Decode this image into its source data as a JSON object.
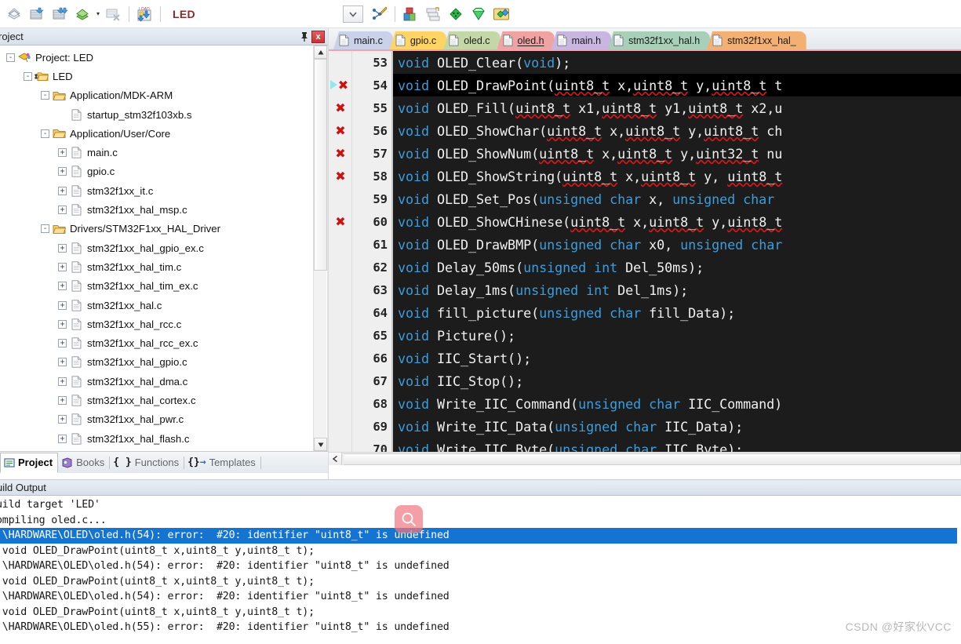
{
  "toolbar": {
    "target_name": "LED",
    "buttons": [
      {
        "name": "translate-icon",
        "icon": "translate"
      },
      {
        "name": "build-icon",
        "icon": "build"
      },
      {
        "name": "rebuild-icon",
        "icon": "rebuild"
      },
      {
        "name": "batch-build-icon",
        "icon": "batchbuild"
      },
      {
        "name": "stop-build-icon",
        "icon": "stopbuild"
      },
      {
        "name": "download-icon",
        "icon": "download"
      }
    ],
    "right_buttons": [
      {
        "name": "target-options-icon",
        "icon": "magicwand"
      },
      {
        "name": "manage-project-items-icon",
        "icon": "project"
      },
      {
        "name": "manage-multi-project-icon",
        "icon": "multiproj"
      },
      {
        "name": "pack-installer-icon",
        "icon": "green-diamond"
      },
      {
        "name": "manage-runtime-env-icon",
        "icon": "green-gem"
      },
      {
        "name": "components-icon",
        "icon": "components"
      }
    ],
    "combo_caret": "▾"
  },
  "project_panel": {
    "title": "roject",
    "pin_tooltip": "Auto Hide",
    "close_label": "x",
    "tree": [
      {
        "label": "Project: LED",
        "depth": 0,
        "twist": "-",
        "icon": "project",
        "bold": false
      },
      {
        "label": "LED",
        "depth": 1,
        "twist": "-",
        "icon": "target",
        "bold": false
      },
      {
        "label": "Application/MDK-ARM",
        "depth": 2,
        "twist": "-",
        "icon": "folder",
        "bold": false
      },
      {
        "label": "startup_stm32f103xb.s",
        "depth": 3,
        "twist": "",
        "icon": "file",
        "bold": false
      },
      {
        "label": "Application/User/Core",
        "depth": 2,
        "twist": "-",
        "icon": "folder",
        "bold": false
      },
      {
        "label": "main.c",
        "depth": 3,
        "twist": "+",
        "icon": "file",
        "bold": false
      },
      {
        "label": "gpio.c",
        "depth": 3,
        "twist": "+",
        "icon": "file",
        "bold": false
      },
      {
        "label": "stm32f1xx_it.c",
        "depth": 3,
        "twist": "+",
        "icon": "file",
        "bold": false
      },
      {
        "label": "stm32f1xx_hal_msp.c",
        "depth": 3,
        "twist": "+",
        "icon": "file",
        "bold": false
      },
      {
        "label": "Drivers/STM32F1xx_HAL_Driver",
        "depth": 2,
        "twist": "-",
        "icon": "folder",
        "bold": false
      },
      {
        "label": "stm32f1xx_hal_gpio_ex.c",
        "depth": 3,
        "twist": "+",
        "icon": "file",
        "bold": false
      },
      {
        "label": "stm32f1xx_hal_tim.c",
        "depth": 3,
        "twist": "+",
        "icon": "file",
        "bold": false
      },
      {
        "label": "stm32f1xx_hal_tim_ex.c",
        "depth": 3,
        "twist": "+",
        "icon": "file",
        "bold": false
      },
      {
        "label": "stm32f1xx_hal.c",
        "depth": 3,
        "twist": "+",
        "icon": "file",
        "bold": false
      },
      {
        "label": "stm32f1xx_hal_rcc.c",
        "depth": 3,
        "twist": "+",
        "icon": "file",
        "bold": false
      },
      {
        "label": "stm32f1xx_hal_rcc_ex.c",
        "depth": 3,
        "twist": "+",
        "icon": "file",
        "bold": false
      },
      {
        "label": "stm32f1xx_hal_gpio.c",
        "depth": 3,
        "twist": "+",
        "icon": "file",
        "bold": false
      },
      {
        "label": "stm32f1xx_hal_dma.c",
        "depth": 3,
        "twist": "+",
        "icon": "file",
        "bold": false
      },
      {
        "label": "stm32f1xx_hal_cortex.c",
        "depth": 3,
        "twist": "+",
        "icon": "file",
        "bold": false
      },
      {
        "label": "stm32f1xx_hal_pwr.c",
        "depth": 3,
        "twist": "+",
        "icon": "file",
        "bold": false
      },
      {
        "label": "stm32f1xx_hal_flash.c",
        "depth": 3,
        "twist": "+",
        "icon": "file",
        "bold": false
      }
    ],
    "bottom_tabs": [
      {
        "label": "Project",
        "icon": "project-icon",
        "active": true
      },
      {
        "label": "Books",
        "icon": "books-icon",
        "active": false
      },
      {
        "label": "Functions",
        "icon": "functions-icon",
        "active": false
      },
      {
        "label": "Templates",
        "icon": "templates-icon",
        "active": false
      }
    ]
  },
  "editor": {
    "tabs": [
      {
        "label": "main.c",
        "color": "#c9d2e8",
        "active": false
      },
      {
        "label": "gpio.c",
        "color": "#ffd465",
        "active": false
      },
      {
        "label": "oled.c",
        "color": "#c3d8a6",
        "active": false
      },
      {
        "label": "oled.h",
        "color": "#f0a3a3",
        "active": true
      },
      {
        "label": "main.h",
        "color": "#c8b6e0",
        "active": false
      },
      {
        "label": "stm32f1xx_hal.h",
        "color": "#a8cfb8",
        "active": false
      },
      {
        "label": "stm32f1xx_hal_",
        "color": "#f2b173",
        "active": false
      }
    ],
    "first_line": 53,
    "lines": [
      {
        "num": 53,
        "marker": "none",
        "highlight": false,
        "tokens": [
          {
            "t": "void ",
            "c": "kw"
          },
          {
            "t": "OLED_Clear(",
            "c": "id"
          },
          {
            "t": "void",
            "c": "kw"
          },
          {
            "t": ");",
            "c": "id"
          }
        ]
      },
      {
        "num": 54,
        "marker": "error-bp",
        "highlight": true,
        "tokens": [
          {
            "t": "void ",
            "c": "kw"
          },
          {
            "t": "OLED_DrawPoint(",
            "c": "id"
          },
          {
            "t": "uint8_t",
            "c": "sq"
          },
          {
            "t": " x,",
            "c": "id"
          },
          {
            "t": "uint8_t",
            "c": "sq"
          },
          {
            "t": " y,",
            "c": "id"
          },
          {
            "t": "uint8_t",
            "c": "sq"
          },
          {
            "t": " t",
            "c": "id"
          }
        ]
      },
      {
        "num": 55,
        "marker": "error",
        "highlight": false,
        "tokens": [
          {
            "t": "void ",
            "c": "kw"
          },
          {
            "t": "OLED_Fill(",
            "c": "id"
          },
          {
            "t": "uint8_t",
            "c": "sq"
          },
          {
            "t": " x1,",
            "c": "id"
          },
          {
            "t": "uint8_t",
            "c": "sq"
          },
          {
            "t": " y1,",
            "c": "id"
          },
          {
            "t": "uint8_t",
            "c": "sq"
          },
          {
            "t": " x2,u",
            "c": "id"
          }
        ]
      },
      {
        "num": 56,
        "marker": "error",
        "highlight": false,
        "tokens": [
          {
            "t": "void ",
            "c": "kw"
          },
          {
            "t": "OLED_ShowChar(",
            "c": "id"
          },
          {
            "t": "uint8_t",
            "c": "sq"
          },
          {
            "t": " x,",
            "c": "id"
          },
          {
            "t": "uint8_t",
            "c": "sq"
          },
          {
            "t": " y,",
            "c": "id"
          },
          {
            "t": "uint8_t",
            "c": "sq"
          },
          {
            "t": " ch",
            "c": "id"
          }
        ]
      },
      {
        "num": 57,
        "marker": "error",
        "highlight": false,
        "tokens": [
          {
            "t": "void ",
            "c": "kw"
          },
          {
            "t": "OLED_ShowNum(",
            "c": "id"
          },
          {
            "t": "uint8_t",
            "c": "sq"
          },
          {
            "t": " x,",
            "c": "id"
          },
          {
            "t": "uint8_t",
            "c": "sq"
          },
          {
            "t": " y,",
            "c": "id"
          },
          {
            "t": "uint32_t",
            "c": "sq"
          },
          {
            "t": " nu",
            "c": "id"
          }
        ]
      },
      {
        "num": 58,
        "marker": "error",
        "highlight": false,
        "tokens": [
          {
            "t": "void ",
            "c": "kw"
          },
          {
            "t": "OLED_ShowString(",
            "c": "id"
          },
          {
            "t": "uint8_t",
            "c": "sq"
          },
          {
            "t": " x,",
            "c": "id"
          },
          {
            "t": "uint8_t",
            "c": "sq"
          },
          {
            "t": " y, ",
            "c": "id"
          },
          {
            "t": "uint8_t",
            "c": "sq"
          }
        ]
      },
      {
        "num": 59,
        "marker": "none",
        "highlight": false,
        "tokens": [
          {
            "t": "void ",
            "c": "kw"
          },
          {
            "t": "OLED_Set_Pos(",
            "c": "id"
          },
          {
            "t": "unsigned char",
            "c": "kw"
          },
          {
            "t": " x, ",
            "c": "id"
          },
          {
            "t": "unsigned char",
            "c": "kw"
          }
        ]
      },
      {
        "num": 60,
        "marker": "error",
        "highlight": false,
        "tokens": [
          {
            "t": "void ",
            "c": "kw"
          },
          {
            "t": "OLED_ShowCHinese(",
            "c": "id"
          },
          {
            "t": "uint8_t",
            "c": "sq"
          },
          {
            "t": " x,",
            "c": "id"
          },
          {
            "t": "uint8_t",
            "c": "sq"
          },
          {
            "t": " y,",
            "c": "id"
          },
          {
            "t": "uint8_t",
            "c": "sq"
          }
        ]
      },
      {
        "num": 61,
        "marker": "none",
        "highlight": false,
        "tokens": [
          {
            "t": "void ",
            "c": "kw"
          },
          {
            "t": "OLED_DrawBMP(",
            "c": "id"
          },
          {
            "t": "unsigned char",
            "c": "kw"
          },
          {
            "t": " x0, ",
            "c": "id"
          },
          {
            "t": "unsigned char",
            "c": "kw"
          }
        ]
      },
      {
        "num": 62,
        "marker": "none",
        "highlight": false,
        "tokens": [
          {
            "t": "void ",
            "c": "kw"
          },
          {
            "t": "Delay_50ms(",
            "c": "id"
          },
          {
            "t": "unsigned int",
            "c": "kw"
          },
          {
            "t": " Del_50ms);",
            "c": "id"
          }
        ]
      },
      {
        "num": 63,
        "marker": "none",
        "highlight": false,
        "tokens": [
          {
            "t": "void ",
            "c": "kw"
          },
          {
            "t": "Delay_1ms(",
            "c": "id"
          },
          {
            "t": "unsigned int",
            "c": "kw"
          },
          {
            "t": " Del_1ms);",
            "c": "id"
          }
        ]
      },
      {
        "num": 64,
        "marker": "none",
        "highlight": false,
        "tokens": [
          {
            "t": "void ",
            "c": "kw"
          },
          {
            "t": "fill_picture(",
            "c": "id"
          },
          {
            "t": "unsigned char",
            "c": "kw"
          },
          {
            "t": " fill_Data);",
            "c": "id"
          }
        ]
      },
      {
        "num": 65,
        "marker": "none",
        "highlight": false,
        "tokens": [
          {
            "t": "void ",
            "c": "kw"
          },
          {
            "t": "Picture();",
            "c": "id"
          }
        ]
      },
      {
        "num": 66,
        "marker": "none",
        "highlight": false,
        "tokens": [
          {
            "t": "void ",
            "c": "kw"
          },
          {
            "t": "IIC_Start();",
            "c": "id"
          }
        ]
      },
      {
        "num": 67,
        "marker": "none",
        "highlight": false,
        "tokens": [
          {
            "t": "void ",
            "c": "kw"
          },
          {
            "t": "IIC_Stop();",
            "c": "id"
          }
        ]
      },
      {
        "num": 68,
        "marker": "none",
        "highlight": false,
        "tokens": [
          {
            "t": "void ",
            "c": "kw"
          },
          {
            "t": "Write_IIC_Command(",
            "c": "id"
          },
          {
            "t": "unsigned char",
            "c": "kw"
          },
          {
            "t": " IIC_Command)",
            "c": "id"
          }
        ]
      },
      {
        "num": 69,
        "marker": "none",
        "highlight": false,
        "tokens": [
          {
            "t": "void ",
            "c": "kw"
          },
          {
            "t": "Write_IIC_Data(",
            "c": "id"
          },
          {
            "t": "unsigned char",
            "c": "kw"
          },
          {
            "t": " IIC_Data);",
            "c": "id"
          }
        ]
      },
      {
        "num": 70,
        "marker": "none",
        "highlight": false,
        "tokens": [
          {
            "t": "void ",
            "c": "kw"
          },
          {
            "t": "Write_IIC_Byte(",
            "c": "id"
          },
          {
            "t": "unsigned char",
            "c": "kw"
          },
          {
            "t": " IIC_Byte);",
            "c": "id"
          }
        ]
      }
    ]
  },
  "build_output": {
    "title": "uild Output",
    "lines": [
      {
        "text": "uild target 'LED'",
        "selected": false
      },
      {
        "text": "ompiling oled.c...",
        "selected": false
      },
      {
        "text": ".\\HARDWARE\\OLED\\oled.h(54): error:  #20: identifier \"uint8_t\" is undefined",
        "selected": true
      },
      {
        "text": " void OLED_DrawPoint(uint8_t x,uint8_t y,uint8_t t);",
        "selected": false
      },
      {
        "text": ".\\HARDWARE\\OLED\\oled.h(54): error:  #20: identifier \"uint8_t\" is undefined",
        "selected": false
      },
      {
        "text": " void OLED_DrawPoint(uint8_t x,uint8_t y,uint8_t t);",
        "selected": false
      },
      {
        "text": ".\\HARDWARE\\OLED\\oled.h(54): error:  #20: identifier \"uint8_t\" is undefined",
        "selected": false
      },
      {
        "text": " void OLED_DrawPoint(uint8_t x,uint8_t y,uint8_t t);",
        "selected": false
      },
      {
        "text": ".\\HARDWARE\\OLED\\oled.h(55): error:  #20: identifier \"uint8_t\" is undefined",
        "selected": false
      }
    ],
    "magnifier_icon": "search-icon"
  },
  "watermark": {
    "text": "CSDN @好家伙VCC"
  },
  "colors": {
    "selection_blue": "#1573d1",
    "editor_bg": "#1c1c1c",
    "keyword_blue": "#3b9ddd",
    "error_red": "#cc1111",
    "active_tab": "#f0a3a3"
  }
}
